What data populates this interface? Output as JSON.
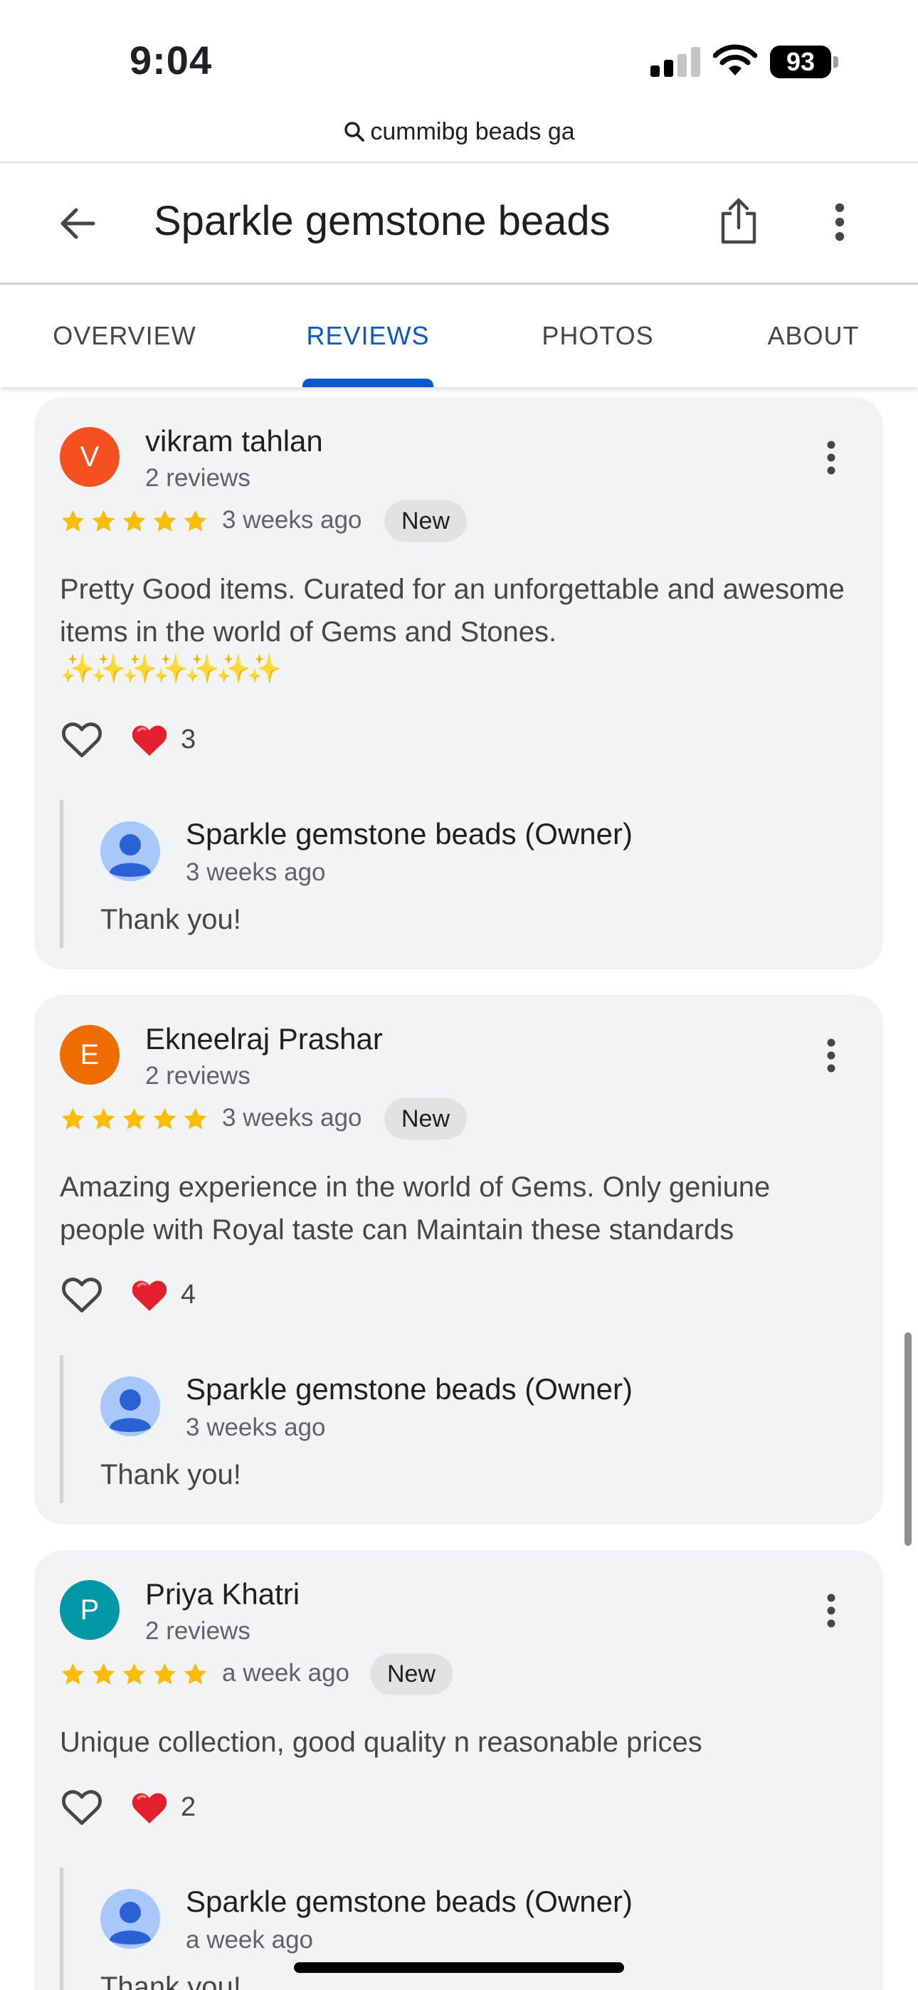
{
  "status_bar": {
    "time": "9:04",
    "battery": "93"
  },
  "url_bar": {
    "query": "cummibg beads ga",
    "icon": "search-icon"
  },
  "header": {
    "title": "Sparkle gemstone beads",
    "back_icon": "arrow-back-icon",
    "share_icon": "share-icon",
    "more_icon": "more-vert-icon"
  },
  "tabs": [
    {
      "label": "OVERVIEW",
      "active": false
    },
    {
      "label": "REVIEWS",
      "active": true
    },
    {
      "label": "PHOTOS",
      "active": false
    },
    {
      "label": "ABOUT",
      "active": false
    }
  ],
  "colors": {
    "accent": "#0b57d0",
    "star": "#fbbc04",
    "card_bg": "#f2f3f5",
    "heart": "#e5202e"
  },
  "reviews": [
    {
      "initial": "V",
      "avatar_color": "#f4511e",
      "name": "vikram tahlan",
      "review_count": "2 reviews",
      "rating": 5,
      "time": "3 weeks ago",
      "badge": "New",
      "text": "Pretty Good items. Curated for an unforgettable and awesome items in the world of Gems and Stones.",
      "sparkles": "✨✨✨✨✨✨✨",
      "likes": "3",
      "owner_reply": {
        "name": "Sparkle gemstone beads (Owner)",
        "time": "3 weeks ago",
        "text": "Thank you!"
      }
    },
    {
      "initial": "E",
      "avatar_color": "#ef6c00",
      "name": "Ekneelraj Prashar",
      "review_count": "2 reviews",
      "rating": 5,
      "time": "3 weeks ago",
      "badge": "New",
      "text": "Amazing experience in the world of Gems. Only geniune people with Royal taste can Maintain these standards",
      "likes": "4",
      "owner_reply": {
        "name": "Sparkle gemstone beads (Owner)",
        "time": "3 weeks ago",
        "text": "Thank you!"
      }
    },
    {
      "initial": "P",
      "avatar_color": "#0097a7",
      "name": "Priya Khatri",
      "review_count": "2 reviews",
      "rating": 5,
      "time": "a week ago",
      "badge": "New",
      "text": "Unique collection, good quality n reasonable prices",
      "likes": "2",
      "owner_reply": {
        "name": "Sparkle gemstone beads (Owner)",
        "time": "a week ago",
        "text": "Thank you!"
      }
    }
  ]
}
